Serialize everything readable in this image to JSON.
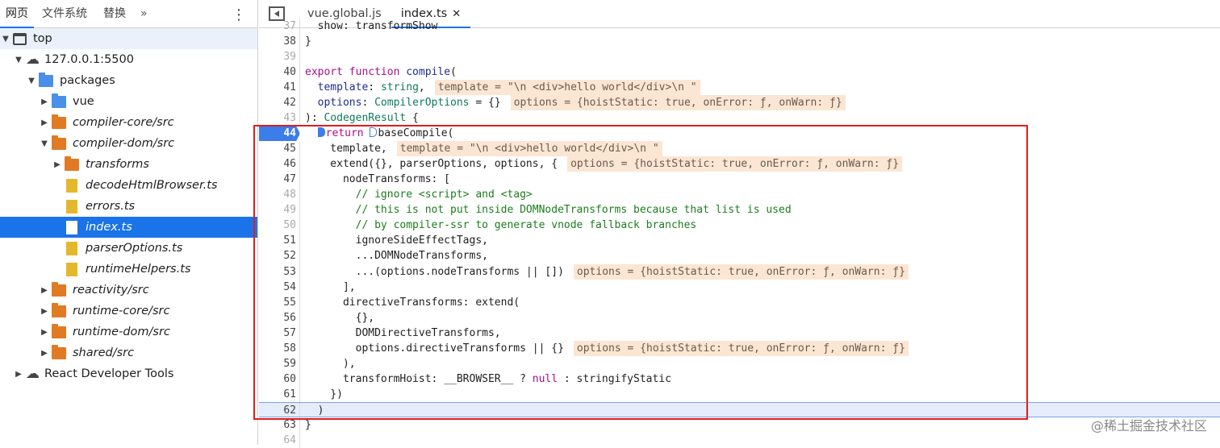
{
  "sidebar": {
    "tabs": [
      "网页",
      "文件系统",
      "替换"
    ],
    "more": "»",
    "menu": "⋮",
    "tree": [
      {
        "label": "top",
        "level": 0,
        "open": true,
        "icon": "window",
        "hover": true
      },
      {
        "label": "127.0.0.1:5500",
        "level": 1,
        "open": true,
        "icon": "cloud"
      },
      {
        "label": "packages",
        "level": 2,
        "open": true,
        "icon": "folder-blue"
      },
      {
        "label": "vue",
        "level": 3,
        "open": false,
        "icon": "folder-blue"
      },
      {
        "label": "compiler-core/src",
        "level": 3,
        "open": false,
        "icon": "folder-orange",
        "italic": true
      },
      {
        "label": "compiler-dom/src",
        "level": 3,
        "open": true,
        "icon": "folder-orange",
        "italic": true
      },
      {
        "label": "transforms",
        "level": 4,
        "open": false,
        "icon": "folder-orange",
        "italic": true
      },
      {
        "label": "decodeHtmlBrowser.ts",
        "level": 4,
        "icon": "file",
        "italic": true
      },
      {
        "label": "errors.ts",
        "level": 4,
        "icon": "file",
        "italic": true
      },
      {
        "label": "index.ts",
        "level": 4,
        "icon": "file",
        "italic": true,
        "selected": true
      },
      {
        "label": "parserOptions.ts",
        "level": 4,
        "icon": "file",
        "italic": true
      },
      {
        "label": "runtimeHelpers.ts",
        "level": 4,
        "icon": "file",
        "italic": true
      },
      {
        "label": "reactivity/src",
        "level": 3,
        "open": false,
        "icon": "folder-orange",
        "italic": true
      },
      {
        "label": "runtime-core/src",
        "level": 3,
        "open": false,
        "icon": "folder-orange",
        "italic": true
      },
      {
        "label": "runtime-dom/src",
        "level": 3,
        "open": false,
        "icon": "folder-orange",
        "italic": true
      },
      {
        "label": "shared/src",
        "level": 3,
        "open": false,
        "icon": "folder-orange",
        "italic": true
      },
      {
        "label": "React Developer Tools",
        "level": 1,
        "open": false,
        "icon": "cloud"
      }
    ]
  },
  "editor": {
    "tabs": [
      {
        "label": "vue.global.js"
      },
      {
        "label": "index.ts",
        "active": true,
        "close": "✕"
      }
    ],
    "lines": [
      {
        "n": "37",
        "dim": true,
        "tokens": [
          [
            "  show: transformShow",
            "pl"
          ]
        ]
      },
      {
        "n": "38",
        "tokens": [
          [
            "}",
            "pl"
          ]
        ]
      },
      {
        "n": "39",
        "dim": true,
        "tokens": []
      },
      {
        "n": "40",
        "tokens": [
          [
            "export function ",
            "kw"
          ],
          [
            "compile",
            "fn"
          ],
          [
            "(",
            "pl"
          ]
        ]
      },
      {
        "n": "41",
        "tokens": [
          [
            "  template",
            "pm"
          ],
          [
            ": ",
            "pl"
          ],
          [
            "string",
            "ty"
          ],
          [
            ",",
            "pl"
          ]
        ],
        "inline": "template = \"\\n <div>hello world</div>\\n \""
      },
      {
        "n": "42",
        "tokens": [
          [
            "  options",
            "pm"
          ],
          [
            ": ",
            "pl"
          ],
          [
            "CompilerOptions",
            "ty"
          ],
          [
            " = {}",
            "pl"
          ]
        ],
        "inline": "options = {hoistStatic: true, onError: ƒ, onWarn: ƒ}"
      },
      {
        "n": "43",
        "dim": true,
        "tokens": [
          [
            "): ",
            "pl"
          ],
          [
            "CodegenResult",
            "ty"
          ],
          [
            " {",
            "pl"
          ]
        ]
      },
      {
        "n": "44",
        "bp": true,
        "tokens": [
          [
            "  ",
            "pl"
          ],
          [
            "@BP",
            "bp"
          ],
          [
            "return ",
            "kw"
          ],
          [
            "@BPE",
            "bp"
          ],
          [
            "baseCompile(",
            "pl"
          ]
        ]
      },
      {
        "n": "45",
        "tokens": [
          [
            "    template,",
            "pl"
          ]
        ],
        "inline": "template = \"\\n <div>hello world</div>\\n \""
      },
      {
        "n": "46",
        "tokens": [
          [
            "    extend({}, parserOptions, options, {",
            "pl"
          ]
        ],
        "inline": "options = {hoistStatic: true, onError: ƒ, onWarn: ƒ}"
      },
      {
        "n": "47",
        "tokens": [
          [
            "      nodeTransforms: [",
            "pl"
          ]
        ]
      },
      {
        "n": "48",
        "dim": true,
        "tokens": [
          [
            "        // ignore <script> and <tag>",
            "cm"
          ]
        ]
      },
      {
        "n": "49",
        "dim": true,
        "tokens": [
          [
            "        // this is not put inside DOMNodeTransforms because that list is used",
            "cm"
          ]
        ]
      },
      {
        "n": "50",
        "dim": true,
        "tokens": [
          [
            "        // by compiler-ssr to generate vnode fallback branches",
            "cm"
          ]
        ]
      },
      {
        "n": "51",
        "tokens": [
          [
            "        ignoreSideEffectTags,",
            "pl"
          ]
        ]
      },
      {
        "n": "52",
        "tokens": [
          [
            "        ...DOMNodeTransforms,",
            "pl"
          ]
        ]
      },
      {
        "n": "53",
        "tokens": [
          [
            "        ...(options.nodeTransforms || [])",
            "pl"
          ]
        ],
        "inline": "options = {hoistStatic: true, onError: ƒ, onWarn: ƒ}"
      },
      {
        "n": "54",
        "tokens": [
          [
            "      ],",
            "pl"
          ]
        ]
      },
      {
        "n": "55",
        "tokens": [
          [
            "      directiveTransforms: extend(",
            "pl"
          ]
        ]
      },
      {
        "n": "56",
        "tokens": [
          [
            "        {},",
            "pl"
          ]
        ]
      },
      {
        "n": "57",
        "tokens": [
          [
            "        DOMDirectiveTransforms,",
            "pl"
          ]
        ]
      },
      {
        "n": "58",
        "tokens": [
          [
            "        options.directiveTransforms || {}",
            "pl"
          ]
        ],
        "inline": "options = {hoistStatic: true, onError: ƒ, onWarn: ƒ}"
      },
      {
        "n": "59",
        "tokens": [
          [
            "      ),",
            "pl"
          ]
        ]
      },
      {
        "n": "60",
        "tokens": [
          [
            "      transformHoist: __BROWSER__ ? ",
            "pl"
          ],
          [
            "null",
            "kw"
          ],
          [
            " : stringifyStatic",
            "pl"
          ]
        ]
      },
      {
        "n": "61",
        "tokens": [
          [
            "    })",
            "pl"
          ]
        ]
      },
      {
        "n": "62",
        "cur": true,
        "tokens": [
          [
            "  )",
            "pl"
          ]
        ]
      },
      {
        "n": "63",
        "tokens": [
          [
            "}",
            "pl"
          ]
        ]
      },
      {
        "n": "64",
        "dim": true,
        "tokens": []
      }
    ]
  },
  "watermark": "@稀土掘金技术社区"
}
